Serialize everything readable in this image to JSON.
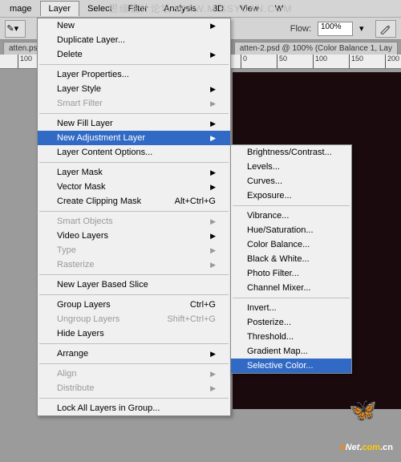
{
  "watermark_top": "思缘设计论坛 WWW.MISSYUAN.COM",
  "menubar": [
    "mage",
    "Layer",
    "Select",
    "Filter",
    "Analysis",
    "3D",
    "View",
    "W"
  ],
  "toolbar": {
    "flow_label": "Flow:",
    "flow_value": "100%"
  },
  "tabs": {
    "left": "atten.ps",
    "right": "atten-2.psd @ 100% (Color Balance 1, Lay"
  },
  "ruler_ticks": [
    {
      "pos": 22,
      "label": "100"
    },
    {
      "pos": 300,
      "label": "0"
    },
    {
      "pos": 345,
      "label": "50"
    },
    {
      "pos": 390,
      "label": "100"
    },
    {
      "pos": 435,
      "label": "150"
    },
    {
      "pos": 480,
      "label": "200"
    }
  ],
  "layer_menu": [
    {
      "type": "item",
      "label": "New",
      "arrow": true
    },
    {
      "type": "item",
      "label": "Duplicate Layer..."
    },
    {
      "type": "item",
      "label": "Delete",
      "arrow": true
    },
    {
      "type": "sep"
    },
    {
      "type": "item",
      "label": "Layer Properties..."
    },
    {
      "type": "item",
      "label": "Layer Style",
      "arrow": true
    },
    {
      "type": "item",
      "label": "Smart Filter",
      "disabled": true,
      "arrow": true
    },
    {
      "type": "sep"
    },
    {
      "type": "item",
      "label": "New Fill Layer",
      "arrow": true
    },
    {
      "type": "item",
      "label": "New Adjustment Layer",
      "arrow": true,
      "highlighted": true
    },
    {
      "type": "item",
      "label": "Layer Content Options..."
    },
    {
      "type": "sep"
    },
    {
      "type": "item",
      "label": "Layer Mask",
      "arrow": true
    },
    {
      "type": "item",
      "label": "Vector Mask",
      "arrow": true
    },
    {
      "type": "item",
      "label": "Create Clipping Mask",
      "shortcut": "Alt+Ctrl+G"
    },
    {
      "type": "sep"
    },
    {
      "type": "item",
      "label": "Smart Objects",
      "disabled": true,
      "arrow": true
    },
    {
      "type": "item",
      "label": "Video Layers",
      "arrow": true
    },
    {
      "type": "item",
      "label": "Type",
      "disabled": true,
      "arrow": true
    },
    {
      "type": "item",
      "label": "Rasterize",
      "disabled": true,
      "arrow": true
    },
    {
      "type": "sep"
    },
    {
      "type": "item",
      "label": "New Layer Based Slice"
    },
    {
      "type": "sep"
    },
    {
      "type": "item",
      "label": "Group Layers",
      "shortcut": "Ctrl+G"
    },
    {
      "type": "item",
      "label": "Ungroup Layers",
      "shortcut": "Shift+Ctrl+G",
      "disabled": true
    },
    {
      "type": "item",
      "label": "Hide Layers"
    },
    {
      "type": "sep"
    },
    {
      "type": "item",
      "label": "Arrange",
      "arrow": true
    },
    {
      "type": "sep"
    },
    {
      "type": "item",
      "label": "Align",
      "disabled": true,
      "arrow": true
    },
    {
      "type": "item",
      "label": "Distribute",
      "disabled": true,
      "arrow": true
    },
    {
      "type": "sep"
    },
    {
      "type": "item",
      "label": "Lock All Layers in Group..."
    }
  ],
  "submenu": [
    {
      "type": "item",
      "label": "Brightness/Contrast..."
    },
    {
      "type": "item",
      "label": "Levels..."
    },
    {
      "type": "item",
      "label": "Curves..."
    },
    {
      "type": "item",
      "label": "Exposure..."
    },
    {
      "type": "sep"
    },
    {
      "type": "item",
      "label": "Vibrance..."
    },
    {
      "type": "item",
      "label": "Hue/Saturation..."
    },
    {
      "type": "item",
      "label": "Color Balance..."
    },
    {
      "type": "item",
      "label": "Black & White..."
    },
    {
      "type": "item",
      "label": "Photo Filter..."
    },
    {
      "type": "item",
      "label": "Channel Mixer..."
    },
    {
      "type": "sep"
    },
    {
      "type": "item",
      "label": "Invert..."
    },
    {
      "type": "item",
      "label": "Posterize..."
    },
    {
      "type": "item",
      "label": "Threshold..."
    },
    {
      "type": "item",
      "label": "Gradient Map..."
    },
    {
      "type": "item",
      "label": "Selective Color...",
      "highlighted": true
    }
  ],
  "logo": {
    "e": "e",
    "net": "Net",
    "dot": ".",
    "com": "com",
    "cn": ".cn"
  }
}
